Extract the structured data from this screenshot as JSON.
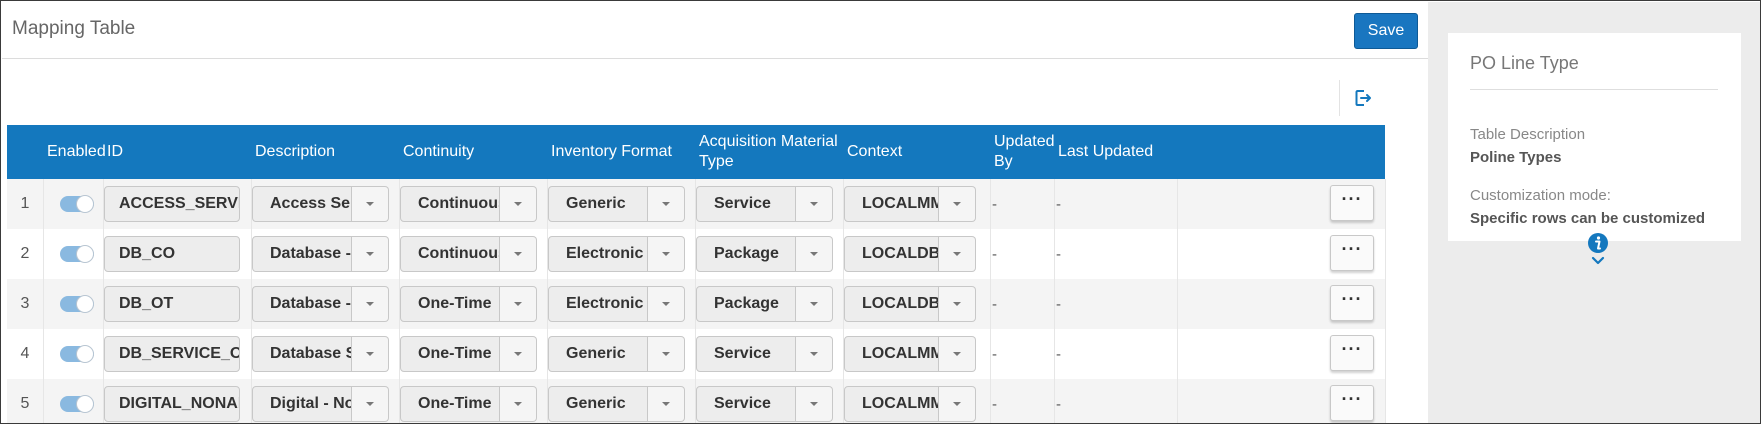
{
  "header": {
    "title": "Mapping Table",
    "save_label": "Save"
  },
  "toolbar": {
    "export_icon": "export-icon"
  },
  "table": {
    "columns": {
      "enabled": "Enabled",
      "id": "ID",
      "description": "Description",
      "continuity": "Continuity",
      "inventory_format": "Inventory Format",
      "acq_material_type_1": "Acquisition Material",
      "acq_material_type_2": "Type",
      "context": "Context",
      "updated_by_1": "Updated",
      "updated_by_2": "By",
      "last_updated": "Last Updated"
    },
    "rows": [
      {
        "num": "1",
        "enabled": true,
        "id": "ACCESS_SERVICE",
        "description": "Access Ser",
        "continuity": "Continuous",
        "inventory_format": "Generic",
        "acq_material_type": "Service",
        "context": "LOCALMMS",
        "updated_by": "-",
        "last_updated": "-",
        "more": "···"
      },
      {
        "num": "2",
        "enabled": true,
        "id": "DB_CO",
        "description": "Database -",
        "continuity": "Continuous",
        "inventory_format": "Electronic",
        "acq_material_type": "Package",
        "context": "LOCALDB,L",
        "updated_by": "-",
        "last_updated": "-",
        "more": "···"
      },
      {
        "num": "3",
        "enabled": true,
        "id": "DB_OT",
        "description": "Database -",
        "continuity": "One-Time",
        "inventory_format": "Electronic",
        "acq_material_type": "Package",
        "context": "LOCALDB,L",
        "updated_by": "-",
        "last_updated": "-",
        "more": "···"
      },
      {
        "num": "4",
        "enabled": true,
        "id": "DB_SERVICE_OT",
        "description": "Database S",
        "continuity": "One-Time",
        "inventory_format": "Generic",
        "acq_material_type": "Service",
        "context": "LOCALMMS",
        "updated_by": "-",
        "last_updated": "-",
        "more": "···"
      },
      {
        "num": "5",
        "enabled": true,
        "id": "DIGITAL_NONARC",
        "description": "Digital - No",
        "continuity": "One-Time",
        "inventory_format": "Generic",
        "acq_material_type": "Service",
        "context": "LOCALMMS",
        "updated_by": "-",
        "last_updated": "-",
        "more": "···"
      }
    ]
  },
  "side_panel": {
    "title": "PO Line Type",
    "table_description_label": "Table Description",
    "table_description_value": "Poline Types",
    "customization_label": "Customization mode:",
    "customization_value": "Specific rows can be customized",
    "info_icon": "info-icon",
    "expand_icon": "chevron-down-icon"
  },
  "colors": {
    "header_bg": "#1478be",
    "save_button": "#1976c0",
    "toggle_on": "#8ab9e0",
    "side_bg": "#ececec"
  }
}
